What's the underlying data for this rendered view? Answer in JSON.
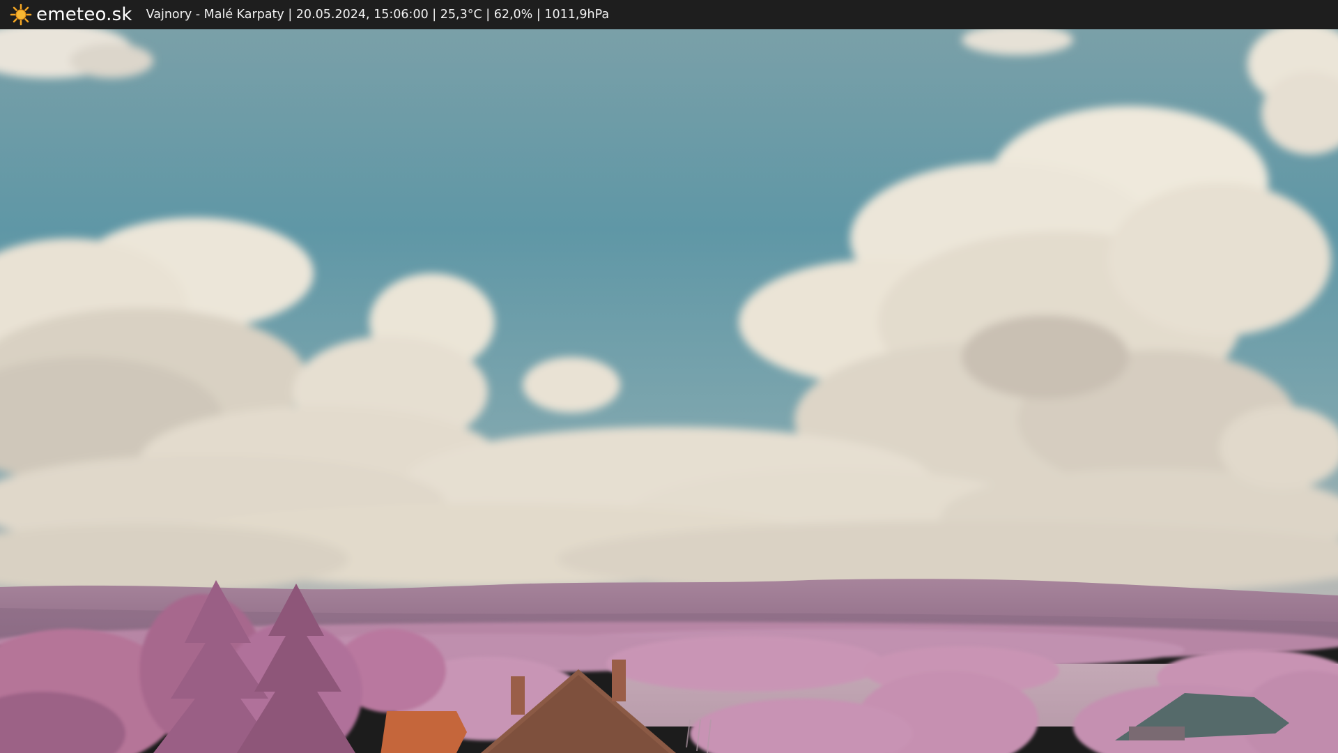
{
  "header": {
    "brand": "emeteo.sk",
    "info": "Vajnory - Malé Karpaty | 20.05.2024, 15:06:00 | 25,3°C | 62,0% | 1011,9hPa",
    "brand_icon": "sun-icon"
  },
  "colors": {
    "bar": "#1e1e1e",
    "sun": "#f4a623",
    "sky_top": "#6f9aa4",
    "sky_mid": "#5a96a6",
    "cloud": "#ebe4d6",
    "hills": "#9a7891",
    "foliage": "#c48fb0",
    "roof": "#c4663c"
  }
}
